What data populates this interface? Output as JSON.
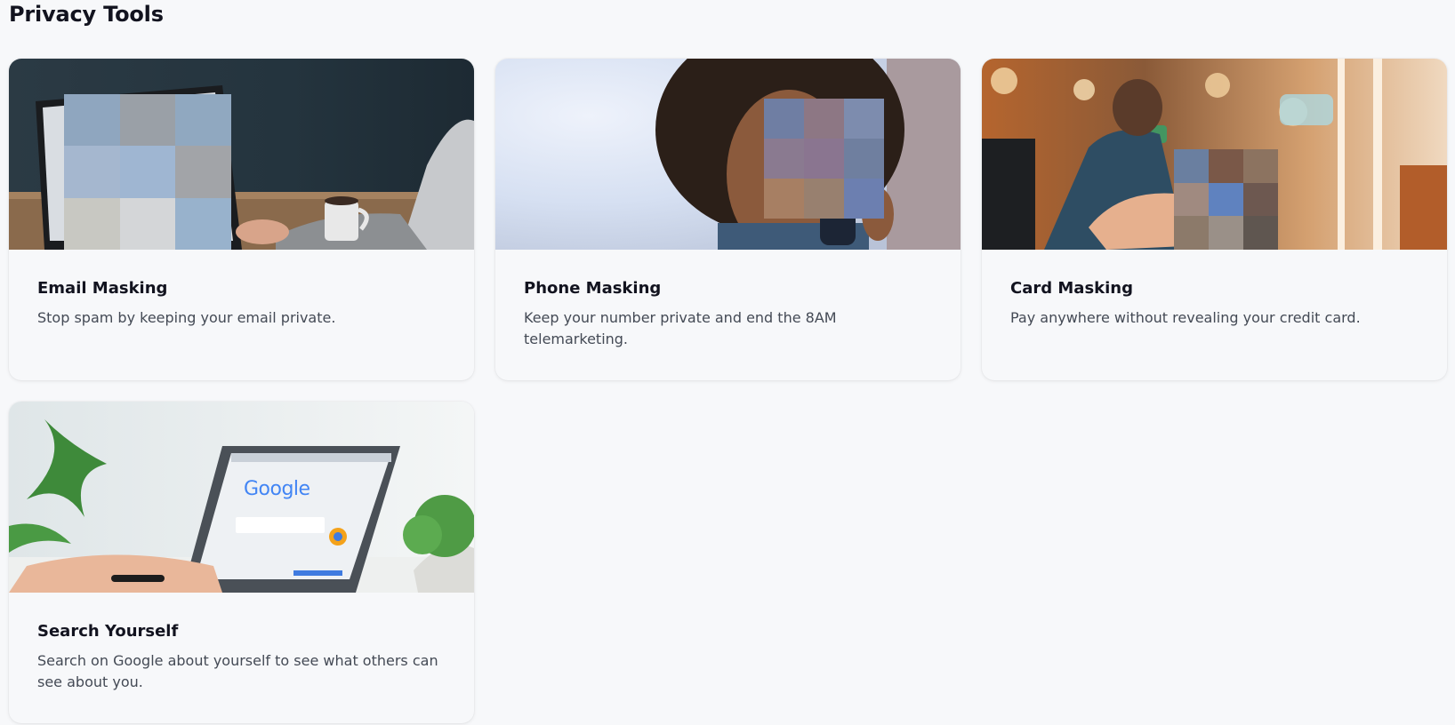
{
  "page": {
    "title": "Privacy Tools"
  },
  "cards": [
    {
      "title": "Email Masking",
      "description": "Stop spam by keeping your email private.",
      "image_icon": "laptop-person-image"
    },
    {
      "title": "Phone Masking",
      "description": "Keep your number private and end the 8AM telemarketing.",
      "image_icon": "person-on-phone-image"
    },
    {
      "title": "Card Masking",
      "description": "Pay anywhere without revealing your credit card.",
      "image_icon": "card-payment-image"
    },
    {
      "title": "Search Yourself",
      "description": "Search on Google about yourself to see what others can see about you.",
      "image_icon": "laptop-google-image"
    }
  ],
  "google_logo": {
    "text": "Google"
  },
  "colors": {
    "background": "#f7f8fa",
    "title": "#12131f",
    "description": "#444a55"
  }
}
